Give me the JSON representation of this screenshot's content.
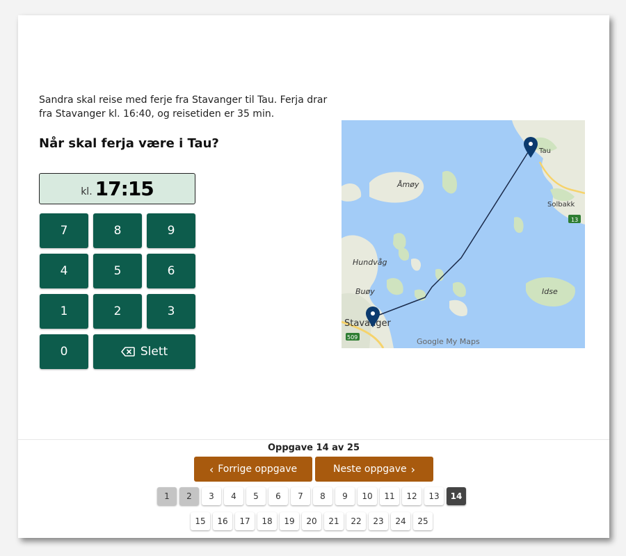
{
  "task": {
    "text": "Sandra skal reise med ferje fra Stavanger til Tau. Ferja drar fra Stavanger kl. 16:40, og reisetiden er 35 min.",
    "question": "Når skal ferja være i Tau?"
  },
  "answer": {
    "prefix": "kl.",
    "value": "17:15"
  },
  "keypad": {
    "keys": [
      "7",
      "8",
      "9",
      "4",
      "5",
      "6",
      "1",
      "2",
      "3",
      "0"
    ],
    "delete_label": "Slett"
  },
  "map": {
    "labels": {
      "tau": "Tau",
      "amoy": "Åmøy",
      "solbakk": "Solbakk",
      "hundvag": "Hundvåg",
      "buoy": "Buøy",
      "idse": "Idse",
      "stavanger": "Stavanger",
      "road_13": "13",
      "road_509": "509",
      "attribution": "Google My Maps"
    },
    "colors": {
      "water": "#a3ccf7",
      "land": "#e8eadd",
      "route": "#1a2a4a",
      "marker": "#0b3a6e"
    }
  },
  "footer": {
    "counter": "Oppgave 14 av 25",
    "prev_label": "Forrige oppgave",
    "next_label": "Neste oppgave",
    "pages": [
      "1",
      "2",
      "3",
      "4",
      "5",
      "6",
      "7",
      "8",
      "9",
      "10",
      "11",
      "12",
      "13",
      "14",
      "15",
      "16",
      "17",
      "18",
      "19",
      "20",
      "21",
      "22",
      "23",
      "24",
      "25"
    ],
    "visited_pages": [
      "1",
      "2"
    ],
    "current_page": "14"
  },
  "colors": {
    "key_bg": "#0d5c4c",
    "nav_bg": "#a85a0e",
    "answer_bg": "#d8eadf"
  }
}
